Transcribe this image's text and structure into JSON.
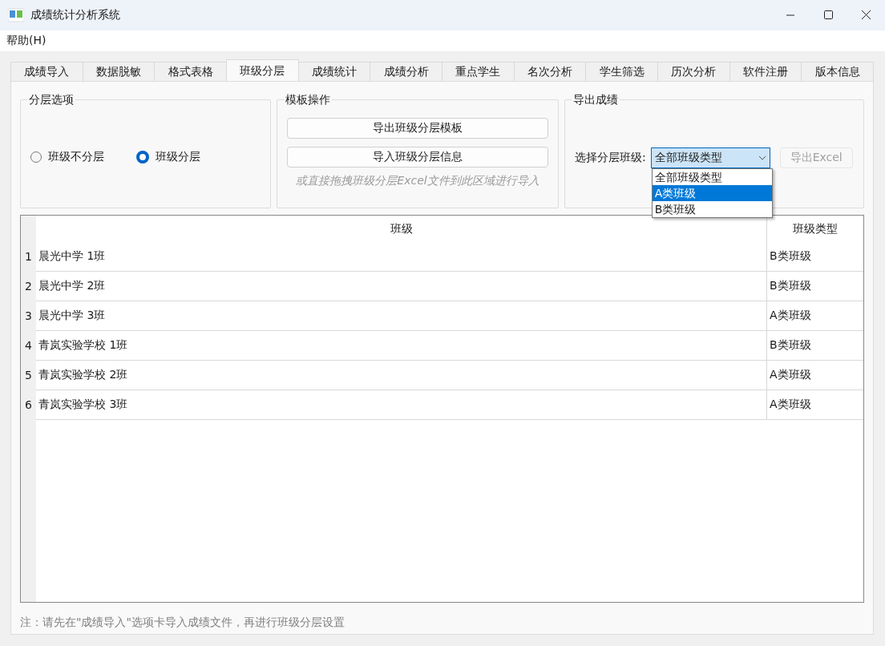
{
  "window": {
    "title": "成绩统计分析系统"
  },
  "menu": [
    {
      "label": "帮助(H)"
    }
  ],
  "tabs": [
    {
      "label": "成绩导入",
      "selected": false
    },
    {
      "label": "数据脱敏",
      "selected": false
    },
    {
      "label": "格式表格",
      "selected": false
    },
    {
      "label": "班级分层",
      "selected": true
    },
    {
      "label": "成绩统计",
      "selected": false
    },
    {
      "label": "成绩分析",
      "selected": false
    },
    {
      "label": "重点学生",
      "selected": false
    },
    {
      "label": "名次分析",
      "selected": false
    },
    {
      "label": "学生筛选",
      "selected": false
    },
    {
      "label": "历次分析",
      "selected": false
    },
    {
      "label": "软件注册",
      "selected": false
    },
    {
      "label": "版本信息",
      "selected": false
    }
  ],
  "layering_options": {
    "title": "分层选项",
    "options": [
      {
        "label": "班级不分层",
        "selected": false
      },
      {
        "label": "班级分层",
        "selected": true
      }
    ]
  },
  "template_ops": {
    "title": "模板操作",
    "buttons": [
      "导出班级分层模板",
      "导入班级分层信息"
    ],
    "hint": "或直接拖拽班级分层Excel文件到此区域进行导入"
  },
  "export": {
    "title": "导出成绩",
    "label": "选择分层班级:",
    "combo": {
      "value": "全部班级类型",
      "expanded": true,
      "options": [
        {
          "label": "全部班级类型",
          "highlighted": false
        },
        {
          "label": "A类班级",
          "highlighted": true
        },
        {
          "label": "B类班级",
          "highlighted": false
        }
      ]
    },
    "export_button": {
      "label": "导出Excel",
      "disabled": true
    }
  },
  "table": {
    "columns": [
      "班级",
      "班级类型"
    ],
    "rows": [
      {
        "number": "1",
        "cells": [
          "晨光中学 1班",
          "B类班级"
        ]
      },
      {
        "number": "2",
        "cells": [
          "晨光中学 2班",
          "B类班级"
        ]
      },
      {
        "number": "3",
        "cells": [
          "晨光中学 3班",
          "A类班级"
        ]
      },
      {
        "number": "4",
        "cells": [
          "青岚实验学校 1班",
          "B类班级"
        ]
      },
      {
        "number": "5",
        "cells": [
          "青岚实验学校 2班",
          "A类班级"
        ]
      },
      {
        "number": "6",
        "cells": [
          "青岚实验学校 3班",
          "A类班级"
        ]
      }
    ]
  },
  "footnote": "注：请先在\"成绩导入\"选项卡导入成绩文件，再进行班级分层设置"
}
